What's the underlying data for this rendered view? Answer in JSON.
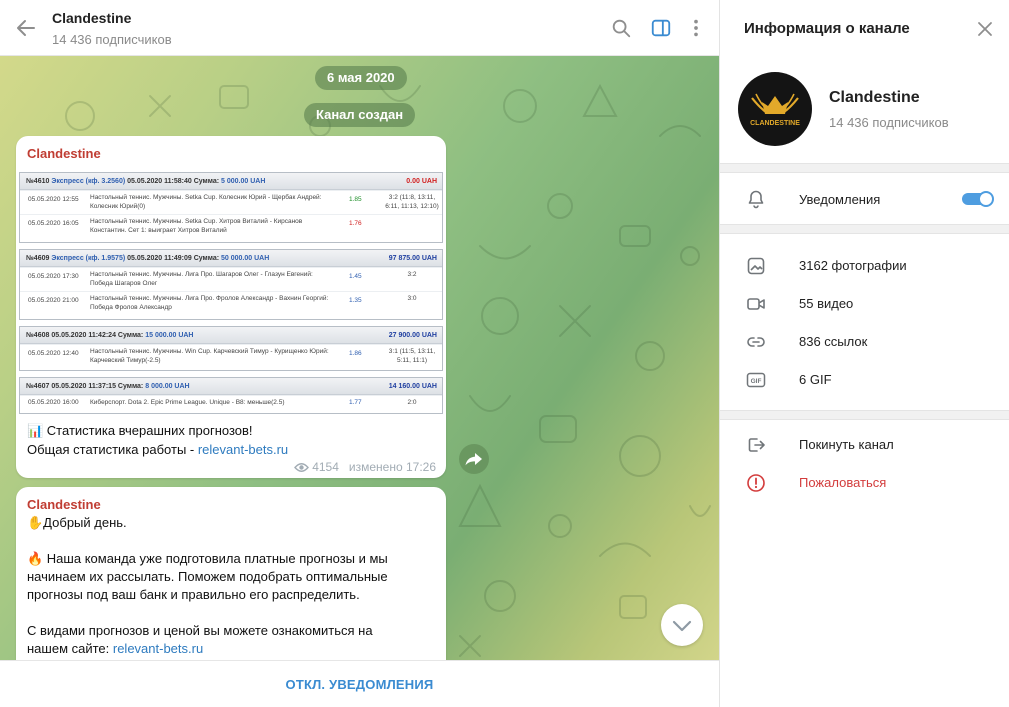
{
  "chat": {
    "title": "Clandestine",
    "subscribers": "14 436 подписчиков",
    "date_pill": "6 мая 2020",
    "service_pill": "Канал создан",
    "footer_button": "ОТКЛ. УВЕДОМЛЕНИЯ",
    "messages": [
      {
        "author": "Clandestine",
        "text_line1": "📊 Статистика вчерашних прогнозов!",
        "text_line2_prefix": "Общая статистика работы - ",
        "text_line2_link": "relevant-bets.ru",
        "views": "4154",
        "edited": "изменено 17:26",
        "bets": [
          {
            "head_id": "№4610",
            "head_express": "Экспресс (кф. 3.2560)",
            "head_date": "05.05.2020 11:58:40",
            "head_sum_label": "Сумма:",
            "head_sum_value": "5 000.00 UAH",
            "result": "0.00 UAH",
            "rows": [
              {
                "date": "05.05.2020 12:55",
                "event": "Настольный теннис. Мужчины. Setka Cup. Колесник Юрий - Щербак Андрей: Колесник Юрий(0)",
                "coef": "1.85",
                "score": "3:2 (11:8, 13:11, 6:11, 11:13, 12:10)"
              },
              {
                "date": "05.05.2020 16:05",
                "event": "Настольный теннис. Мужчины. Setka Cup. Хитров Виталий - Кирсанов Константин. Сет 1: выиграет Хитров Виталий",
                "coef": "1.76",
                "score": ""
              }
            ]
          },
          {
            "head_id": "№4609",
            "head_express": "Экспресс (кф. 1.9575)",
            "head_date": "05.05.2020 11:49:09",
            "head_sum_label": "Сумма:",
            "head_sum_value": "50 000.00 UAH",
            "result": "97 875.00 UAH",
            "rows": [
              {
                "date": "05.05.2020 17:30",
                "event": "Настольный теннис. Мужчины. Лига Про. Шагаров Олег - Глазун Евгений: Победа Шагаров Олег",
                "coef": "1.45",
                "score": "3:2"
              },
              {
                "date": "05.05.2020 21:00",
                "event": "Настольный теннис. Мужчины. Лига Про. Фролов Александр - Вахнин Георгий: Победа Фролов Александр",
                "coef": "1.35",
                "score": "3:0"
              }
            ]
          },
          {
            "head_id": "№4608",
            "head_express": "",
            "head_date": "05.05.2020 11:42:24",
            "head_sum_label": "Сумма:",
            "head_sum_value": "15 000.00 UAH",
            "result": "27 900.00 UAH",
            "rows": [
              {
                "date": "05.05.2020 12:40",
                "event": "Настольный теннис. Мужчины. Win Cup. Карчевский Тимур - Курищенко Юрий: Карчевский Тимур(-2.5)",
                "coef": "1.86",
                "score": "3:1 (11:5, 13:11, 5:11, 11:1)"
              }
            ]
          },
          {
            "head_id": "№4607",
            "head_express": "",
            "head_date": "05.05.2020 11:37:15",
            "head_sum_label": "Сумма:",
            "head_sum_value": "8 000.00 UAH",
            "result": "14 160.00 UAH",
            "rows": [
              {
                "date": "05.05.2020 16:00",
                "event": "Киберспорт. Dota 2. Epic Prime League. Unique - B8: меньше(2.5)",
                "coef": "1.77",
                "score": "2:0"
              }
            ]
          }
        ]
      },
      {
        "author": "Clandestine",
        "line1": "✋Добрый день.",
        "line2": "🔥 Наша команда уже подготовила платные прогнозы и мы",
        "line3": "начинаем их рассылать. Поможем подобрать оптимальные",
        "line4": "прогнозы под ваш банк и правильно его распределить.",
        "line5": "С видами прогнозов и ценой вы можете ознакомиться на",
        "line6_prefix": "нашем сайте: ",
        "line6_link": "relevant-bets.ru"
      }
    ]
  },
  "panel": {
    "title": "Информация о канале",
    "channel_name": "Clandestine",
    "subscribers": "14 436 подписчиков",
    "avatar_text": "CLANDESTINE",
    "notifications_label": "Уведомления",
    "notifications_on": true,
    "media": {
      "photos": "3162 фотографии",
      "videos": "55 видео",
      "links": "836 ссылок",
      "gifs": "6 GIF"
    },
    "gif_badge": "GIF",
    "leave_label": "Покинуть канал",
    "report_label": "Пожаловаться"
  },
  "colors": {
    "accent": "#3a8bd1",
    "author": "#c03d33",
    "danger": "#d33c3c",
    "toggle": "#4e9de0"
  },
  "icons": {
    "back": "arrow-left-icon",
    "search": "search-icon",
    "sidebar": "sidebar-toggle-icon",
    "menu": "more-vertical-icon",
    "close": "close-icon",
    "bell": "bell-icon",
    "photo": "image-icon",
    "video": "video-icon",
    "link": "link-icon",
    "gif": "gif-icon",
    "leave": "leave-icon",
    "report": "report-icon",
    "forward": "forward-icon",
    "scroll": "chevron-down-icon",
    "views": "eye-icon"
  }
}
